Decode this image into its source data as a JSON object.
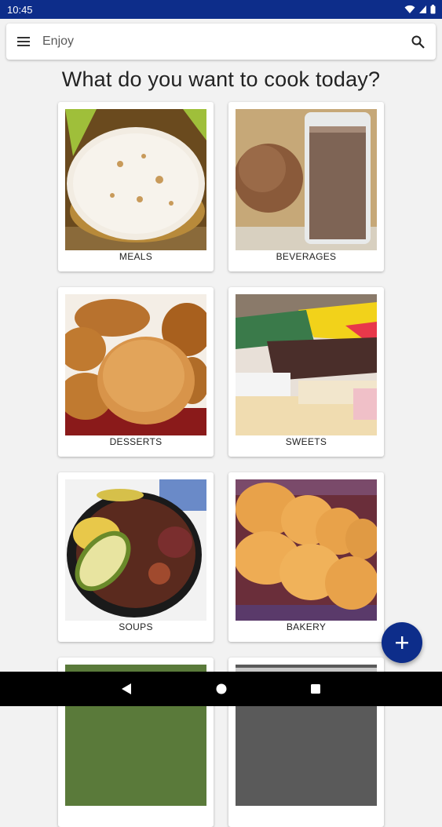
{
  "status_bar": {
    "time": "10:45"
  },
  "app_bar": {
    "title": "Enjoy"
  },
  "heading": "What do you want to cook today?",
  "categories": [
    {
      "label": "MEALS"
    },
    {
      "label": "BEVERAGES"
    },
    {
      "label": "DESSERTS"
    },
    {
      "label": "SWEETS"
    },
    {
      "label": "SOUPS"
    },
    {
      "label": "BAKERY"
    },
    {
      "label": ""
    },
    {
      "label": ""
    }
  ],
  "colors": {
    "primary": "#0d2d8a",
    "background": "#f2f2f2"
  }
}
